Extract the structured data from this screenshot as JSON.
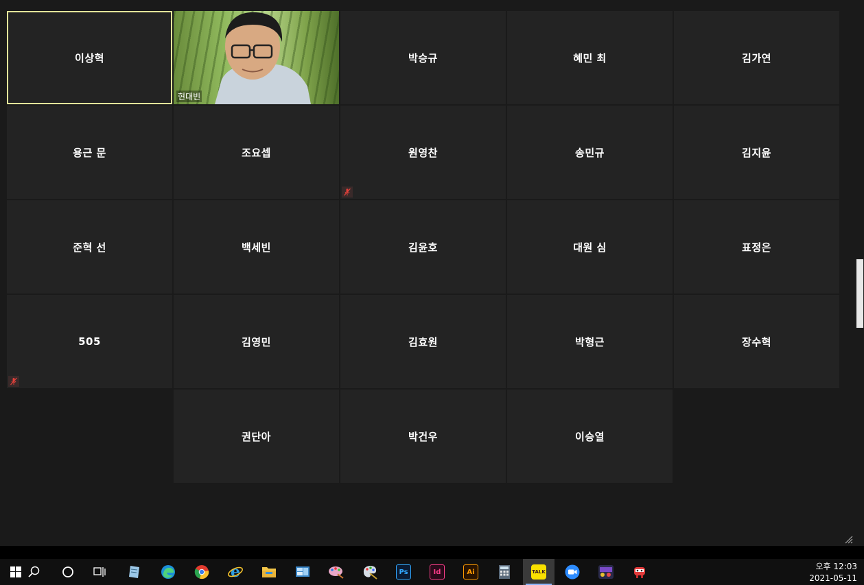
{
  "participants": [
    {
      "name": "이상혁",
      "active": true,
      "muted": false
    },
    {
      "name": "현대빈",
      "video": true,
      "muted": false
    },
    {
      "name": "박승규",
      "muted": false
    },
    {
      "name": "혜민 최",
      "muted": false
    },
    {
      "name": "김가연",
      "muted": false
    },
    {
      "name": "용근 문",
      "muted": false
    },
    {
      "name": "조요셉",
      "muted": false
    },
    {
      "name": "원영찬",
      "muted": true
    },
    {
      "name": "송민규",
      "muted": false
    },
    {
      "name": "김지윤",
      "muted": false
    },
    {
      "name": "준혁 선",
      "muted": false
    },
    {
      "name": "백세빈",
      "muted": false
    },
    {
      "name": "김윤호",
      "muted": false
    },
    {
      "name": "대원 심",
      "muted": false
    },
    {
      "name": "표정은",
      "muted": false
    },
    {
      "name": "505",
      "muted": true
    },
    {
      "name": "김영민",
      "muted": false
    },
    {
      "name": "김효원",
      "muted": false
    },
    {
      "name": "박형근",
      "muted": false
    },
    {
      "name": "장수혁",
      "muted": false
    },
    {
      "name": "권단아",
      "muted": false
    },
    {
      "name": "박건우",
      "muted": false
    },
    {
      "name": "이승열",
      "muted": false
    }
  ],
  "taskbar": {
    "apps": [
      {
        "name": "start",
        "icon": "windows-logo-icon"
      },
      {
        "name": "search",
        "icon": "search-icon"
      },
      {
        "name": "cortana",
        "icon": "circle-icon"
      },
      {
        "name": "task-view",
        "icon": "task-view-icon"
      },
      {
        "name": "notes",
        "icon": "notes-icon"
      },
      {
        "name": "edge",
        "icon": "edge-icon"
      },
      {
        "name": "chrome",
        "icon": "chrome-icon"
      },
      {
        "name": "internet-explorer",
        "icon": "ie-icon"
      },
      {
        "name": "file-explorer",
        "icon": "folder-icon"
      },
      {
        "name": "control-panel",
        "icon": "control-panel-icon"
      },
      {
        "name": "paint-bucket",
        "icon": "paint-icon"
      },
      {
        "name": "paint",
        "icon": "palette-icon"
      },
      {
        "name": "photoshop",
        "icon": "photoshop-icon",
        "label": "Ps"
      },
      {
        "name": "indesign",
        "icon": "indesign-icon",
        "label": "Id"
      },
      {
        "name": "illustrator",
        "icon": "illustrator-icon",
        "label": "Ai"
      },
      {
        "name": "calculator",
        "icon": "calculator-icon"
      },
      {
        "name": "kakaotalk",
        "icon": "kakaotalk-icon",
        "label": "TALK",
        "active": true
      },
      {
        "name": "zoom",
        "icon": "zoom-icon"
      },
      {
        "name": "game",
        "icon": "game-icon"
      },
      {
        "name": "robot",
        "icon": "robot-icon"
      }
    ],
    "clock": {
      "time": "오후 12:03",
      "date": "2021-05-11"
    }
  },
  "colors": {
    "tile": "#232323",
    "active_border": "#e3e59a",
    "background": "#1a1a1a",
    "mute": "#e0403a"
  }
}
